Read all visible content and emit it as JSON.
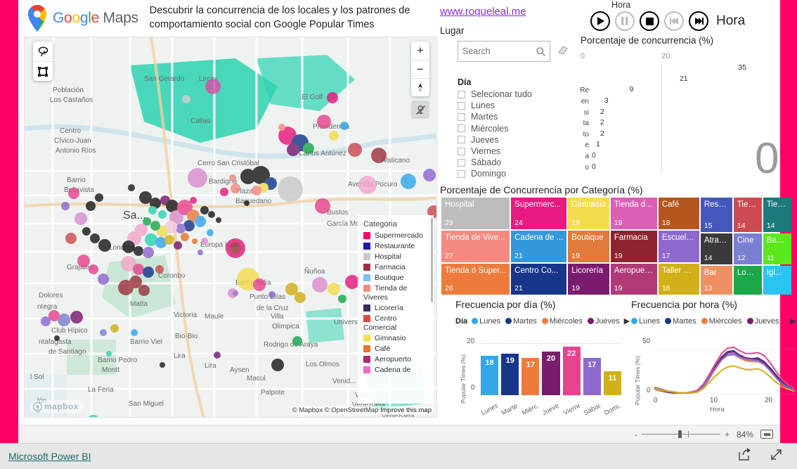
{
  "header": {
    "brand_google": "Google",
    "brand_maps": "Maps",
    "title": "Descubrir la concurrencia de los locales y los patrones de comportamiento social con Google Popular Times",
    "site_link": "www.roqueleal.me"
  },
  "playback": {
    "title": "Hora",
    "label": "Hora",
    "buttons": [
      "play-button",
      "pause-button",
      "stop-button",
      "previous-button",
      "next-button"
    ]
  },
  "map": {
    "attribution_mapbox": "© Mapbox",
    "attribution_osm": "© OpenStreetMap",
    "improve_link": "Improve this map",
    "logo_text": "mapbox",
    "legend": {
      "title": "Categoria",
      "items": [
        {
          "label": "Supermercado",
          "color": "#FF0066"
        },
        {
          "label": "Restaurante",
          "color": "#1A1AA8"
        },
        {
          "label": "Hospital",
          "color": "#C9C9C9"
        },
        {
          "label": "Farmacia",
          "color": "#9E3340"
        },
        {
          "label": "Boutique",
          "color": "#7FC0F0"
        },
        {
          "label": "Tienda de",
          "color": "#F58A80"
        },
        {
          "label": "Viveres",
          "color": "",
          "continuation": true
        },
        {
          "label": "Licorería",
          "color": "#3B2B5E"
        },
        {
          "label": "Centro",
          "color": "#D94A4A"
        },
        {
          "label": "Comercial",
          "color": "",
          "continuation": true
        },
        {
          "label": "Gimnasio",
          "color": "#F5E04A"
        },
        {
          "label": "Café",
          "color": "#E8732A"
        },
        {
          "label": "Aeropuerto",
          "color": "#A82A7A"
        },
        {
          "label": "Cadena de",
          "color": "#EE6BC8"
        }
      ]
    }
  },
  "filters": {
    "lugar_label": "Lugar",
    "search_placeholder": "Search",
    "dia_label": "Día",
    "days": [
      "Selecionar tudo",
      "Lunes",
      "Martes",
      "Miércoles",
      "Jueves",
      "Viernes",
      "Sábado",
      "Domingo"
    ]
  },
  "bignum": {
    "value": "0"
  },
  "chart_data": [
    {
      "type": "bar",
      "orientation": "horizontal",
      "title": "Porcentaje de concurrencia (%)",
      "categories": [
        "",
        "",
        "Re",
        "en",
        "si",
        "ta",
        "to",
        "e",
        "a",
        "o"
      ],
      "values": [
        35,
        21,
        9,
        3,
        2,
        2,
        2,
        1,
        0,
        0
      ],
      "xlabel": "",
      "ylabel": "",
      "xlim": [
        0,
        40
      ],
      "xticks": [
        0,
        20
      ],
      "grid": true,
      "bar_color": "#1a1a1a"
    },
    {
      "type": "treemap",
      "title": "Porcentaje de Concurrencia por Categoría (%)",
      "items": [
        {
          "label": "Hospital",
          "value": 29,
          "color": "#BDBDBD"
        },
        {
          "label": "Tienda de Vive...",
          "value": 27,
          "color": "#F58A80"
        },
        {
          "label": "Tienda ó Super...",
          "value": 26,
          "color": "#EE7B3C"
        },
        {
          "label": "Supermerc...",
          "value": 24,
          "color": "#E8197F"
        },
        {
          "label": "Cadena de ...",
          "value": 21,
          "color": "#3399DD"
        },
        {
          "label": "Centro Co...",
          "value": 21,
          "color": "#17368A"
        },
        {
          "label": "Gimnasio",
          "value": 19,
          "color": "#F5DC4E"
        },
        {
          "label": "Boutique",
          "value": 19,
          "color": "#E07B3A"
        },
        {
          "label": "Licorería",
          "value": 19,
          "color": "#7A1B6E"
        },
        {
          "label": "Tienda d...",
          "value": 19,
          "color": "#DD5EB5"
        },
        {
          "label": "Farmacia",
          "value": 19,
          "color": "#8E2430"
        },
        {
          "label": "Aeropuer...",
          "value": 19,
          "color": "#B03A77"
        },
        {
          "label": "Café",
          "value": 18,
          "color": "#B4561E"
        },
        {
          "label": "Escuela ...",
          "value": 17,
          "color": "#8E68CE"
        },
        {
          "label": "Taller M...",
          "value": 16,
          "color": "#D1B019"
        },
        {
          "label": "Resta...",
          "value": 15,
          "color": "#4457BB"
        },
        {
          "label": "Atracc...",
          "value": 14,
          "color": "#3A3A3A"
        },
        {
          "label": "Bar",
          "value": 13,
          "color": "#EE9062"
        },
        {
          "label": "Tien...",
          "value": 14,
          "color": "#CC4B52"
        },
        {
          "label": "Cine",
          "value": 12,
          "color": "#7B7FD1"
        },
        {
          "label": "Local...",
          "value": null,
          "color": "#1AA84A"
        },
        {
          "label": "Tien...",
          "value": 14,
          "color": "#1C7A7A"
        },
        {
          "label": "Ban...",
          "value": 11,
          "color": "#5CE81C"
        },
        {
          "label": "Igl...",
          "value": null,
          "color": "#2BC4F0"
        }
      ]
    },
    {
      "type": "bar",
      "title": "Frecuencia por día (%)",
      "legend_label": "Día",
      "legend": [
        {
          "name": "Lunes",
          "color": "#33A7E8"
        },
        {
          "name": "Martes",
          "color": "#17368A"
        },
        {
          "name": "Miércoles",
          "color": "#EE7B3C"
        },
        {
          "name": "Jueves",
          "color": "#7A1B6E"
        }
      ],
      "categories": [
        "Lunes",
        "Martes",
        "Miérc...",
        "Jueves",
        "Viernes",
        "Sábado",
        "Domi..."
      ],
      "values": [
        18,
        19,
        17,
        20,
        22,
        17,
        11
      ],
      "colors": [
        "#33A7E8",
        "#17368A",
        "#EE7B3C",
        "#7A1B6E",
        "#E8438E",
        "#8E68CE",
        "#D1B019"
      ],
      "xlabel": "",
      "ylabel": "Popular Times (%)",
      "ylim": [
        0,
        25
      ],
      "yticks": [
        0,
        20
      ],
      "grid": true
    },
    {
      "type": "line",
      "title": "Frecuencia por hora (%)",
      "legend": [
        {
          "name": "Lunes",
          "color": "#33A7E8"
        },
        {
          "name": "Martes",
          "color": "#17368A"
        },
        {
          "name": "Miércoles",
          "color": "#EE7B3C"
        },
        {
          "name": "Jueves",
          "color": "#7A1B6E"
        }
      ],
      "xlabel": "Hora",
      "ylabel": "Popular Times (%)",
      "xlim": [
        0,
        23
      ],
      "ylim": [
        0,
        55
      ],
      "xticks": [
        0,
        10,
        20
      ],
      "yticks": [
        0,
        50
      ],
      "x": [
        0,
        1,
        2,
        3,
        4,
        5,
        6,
        7,
        8,
        9,
        10,
        11,
        12,
        13,
        14,
        15,
        16,
        17,
        18,
        19,
        20,
        21,
        22,
        23
      ],
      "series": [
        {
          "name": "Lunes",
          "color": "#33A7E8",
          "values": [
            6,
            4,
            2,
            1,
            1,
            1,
            1,
            2,
            7,
            17,
            29,
            39,
            44,
            45,
            41,
            38,
            37,
            38,
            35,
            28,
            20,
            13,
            8,
            4
          ]
        },
        {
          "name": "Martes",
          "color": "#17368A",
          "values": [
            5,
            3,
            2,
            1,
            1,
            1,
            1,
            3,
            9,
            20,
            31,
            41,
            47,
            48,
            43,
            40,
            39,
            40,
            36,
            29,
            21,
            13,
            8,
            5
          ]
        },
        {
          "name": "Miércoles",
          "color": "#EE7B3C",
          "values": [
            5,
            3,
            2,
            1,
            1,
            1,
            1,
            2,
            8,
            18,
            28,
            38,
            43,
            44,
            40,
            37,
            36,
            36,
            33,
            26,
            18,
            11,
            7,
            4
          ]
        },
        {
          "name": "Jueves",
          "color": "#7A1B6E",
          "values": [
            6,
            4,
            2,
            1,
            1,
            1,
            1,
            3,
            9,
            19,
            30,
            40,
            46,
            47,
            43,
            40,
            39,
            39,
            35,
            28,
            20,
            12,
            7,
            4
          ]
        },
        {
          "name": "Viernes",
          "color": "#E8438E",
          "values": [
            7,
            5,
            3,
            2,
            1,
            1,
            2,
            4,
            11,
            22,
            34,
            45,
            51,
            52,
            48,
            45,
            45,
            46,
            43,
            35,
            25,
            16,
            10,
            6
          ]
        },
        {
          "name": "Sábado",
          "color": "#8E68CE",
          "values": [
            7,
            5,
            3,
            2,
            1,
            1,
            1,
            3,
            9,
            19,
            29,
            38,
            43,
            44,
            41,
            39,
            38,
            37,
            33,
            26,
            18,
            11,
            7,
            4
          ]
        },
        {
          "name": "Domingo",
          "color": "#D1B019",
          "values": [
            6,
            4,
            3,
            2,
            1,
            1,
            1,
            2,
            6,
            13,
            20,
            26,
            30,
            31,
            29,
            27,
            27,
            28,
            25,
            19,
            13,
            8,
            5,
            3
          ]
        }
      ]
    }
  ],
  "statusbar": {
    "zoom_level": "84%",
    "minus": "-",
    "plus": "+"
  },
  "footer": {
    "powerbi_label": "Microsoft Power BI"
  }
}
